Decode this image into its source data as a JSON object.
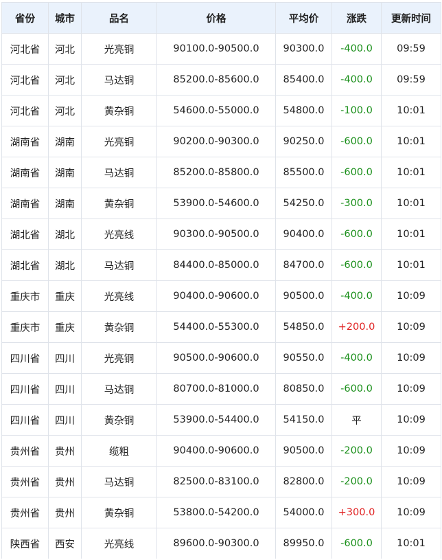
{
  "table": {
    "columns": [
      "省份",
      "城市",
      "品名",
      "价格",
      "平均价",
      "涨跌",
      "更新时间"
    ],
    "rows": [
      {
        "province": "河北省",
        "city": "河北",
        "product": "光亮铜",
        "price": "90100.0-90500.0",
        "avg": "90300.0",
        "change": "-400.0",
        "time": "09:59"
      },
      {
        "province": "河北省",
        "city": "河北",
        "product": "马达铜",
        "price": "85200.0-85600.0",
        "avg": "85400.0",
        "change": "-400.0",
        "time": "09:59"
      },
      {
        "province": "河北省",
        "city": "河北",
        "product": "黄杂铜",
        "price": "54600.0-55000.0",
        "avg": "54800.0",
        "change": "-100.0",
        "time": "10:01"
      },
      {
        "province": "湖南省",
        "city": "湖南",
        "product": "光亮铜",
        "price": "90200.0-90300.0",
        "avg": "90250.0",
        "change": "-600.0",
        "time": "10:01"
      },
      {
        "province": "湖南省",
        "city": "湖南",
        "product": "马达铜",
        "price": "85200.0-85800.0",
        "avg": "85500.0",
        "change": "-600.0",
        "time": "10:01"
      },
      {
        "province": "湖南省",
        "city": "湖南",
        "product": "黄杂铜",
        "price": "53900.0-54600.0",
        "avg": "54250.0",
        "change": "-300.0",
        "time": "10:01"
      },
      {
        "province": "湖北省",
        "city": "湖北",
        "product": "光亮线",
        "price": "90300.0-90500.0",
        "avg": "90400.0",
        "change": "-600.0",
        "time": "10:01"
      },
      {
        "province": "湖北省",
        "city": "湖北",
        "product": "马达铜",
        "price": "84400.0-85000.0",
        "avg": "84700.0",
        "change": "-600.0",
        "time": "10:01"
      },
      {
        "province": "重庆市",
        "city": "重庆",
        "product": "光亮线",
        "price": "90400.0-90600.0",
        "avg": "90500.0",
        "change": "-400.0",
        "time": "10:09"
      },
      {
        "province": "重庆市",
        "city": "重庆",
        "product": "黄杂铜",
        "price": "54400.0-55300.0",
        "avg": "54850.0",
        "change": "+200.0",
        "time": "10:09"
      },
      {
        "province": "四川省",
        "city": "四川",
        "product": "光亮铜",
        "price": "90500.0-90600.0",
        "avg": "90550.0",
        "change": "-400.0",
        "time": "10:09"
      },
      {
        "province": "四川省",
        "city": "四川",
        "product": "马达铜",
        "price": "80700.0-81000.0",
        "avg": "80850.0",
        "change": "-600.0",
        "time": "10:09"
      },
      {
        "province": "四川省",
        "city": "四川",
        "product": "黄杂铜",
        "price": "53900.0-54400.0",
        "avg": "54150.0",
        "change": "平",
        "time": "10:09"
      },
      {
        "province": "贵州省",
        "city": "贵州",
        "product": "缆粗",
        "price": "90400.0-90600.0",
        "avg": "90500.0",
        "change": "-200.0",
        "time": "10:09"
      },
      {
        "province": "贵州省",
        "city": "贵州",
        "product": "马达铜",
        "price": "82500.0-83100.0",
        "avg": "82800.0",
        "change": "-200.0",
        "time": "10:09"
      },
      {
        "province": "贵州省",
        "city": "贵州",
        "product": "黄杂铜",
        "price": "53800.0-54200.0",
        "avg": "54000.0",
        "change": "+300.0",
        "time": "10:09"
      },
      {
        "province": "陕西省",
        "city": "西安",
        "product": "光亮线",
        "price": "89600.0-90300.0",
        "avg": "89950.0",
        "change": "-600.0",
        "time": "10:01"
      }
    ]
  },
  "colors": {
    "header_bg": "#eaf2fc",
    "border": "#dfe3ea",
    "change_down": "#1a8f1a",
    "change_up": "#e02020"
  }
}
